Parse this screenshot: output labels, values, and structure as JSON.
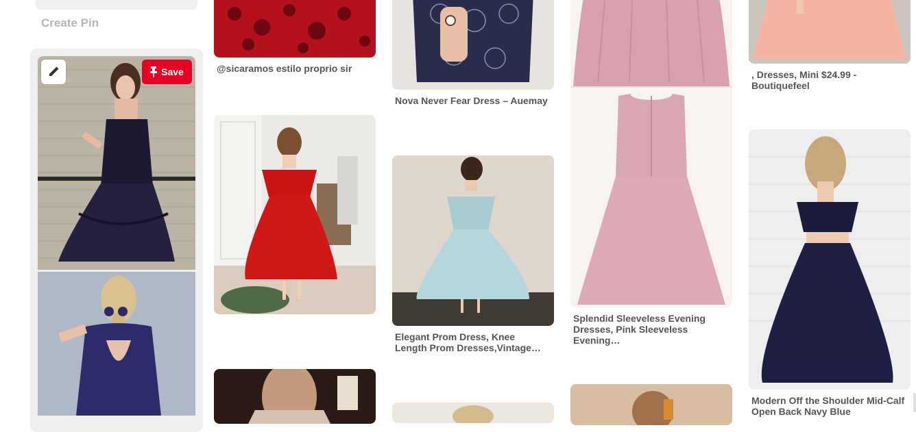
{
  "create_pin": {
    "label": "Create Pin"
  },
  "hover_actions": {
    "save_label": "Save"
  },
  "captions": {
    "pin1": "@sicaramos estilo proprio sir",
    "pin2": "Nova Never Fear Dress – Auemay",
    "pin3": "Elegant Prom Dress, Knee Length Prom Dresses,Vintage…",
    "pin4": "Splendid Sleeveless Evening Dresses, Pink Sleeveless Evening…",
    "pin5": ", Dresses, Mini $24.99 - Boutiquefeel",
    "pin6": "Modern Off the Shoulder Mid-Calf Open Back Navy Blue"
  },
  "colors": {
    "save_red": "#e60023",
    "caption_gray": "#555555",
    "hover_bg": "#efefef"
  }
}
